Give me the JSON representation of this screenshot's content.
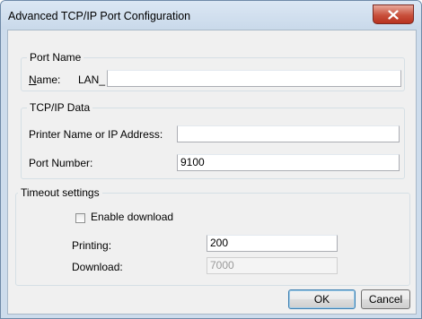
{
  "window": {
    "title": "Advanced TCP/IP Port Configuration"
  },
  "port_name": {
    "group_label": "Port Name",
    "name_label_prefix": "N",
    "name_label_rest": "ame:",
    "name_value": "LAN_"
  },
  "tcpip_data": {
    "group_label": "TCP/IP Data",
    "printer_label": "Printer Name or IP Address:",
    "printer_value": "",
    "port_number_label": "Port Number:",
    "port_number_value": "9100"
  },
  "timeout": {
    "group_label": "Timeout settings",
    "enable_download_label": "Enable download",
    "enable_download_checked": false,
    "printing_label": "Printing:",
    "printing_value": "200",
    "download_label": "Download:",
    "download_value": "7000"
  },
  "buttons": {
    "ok": "OK",
    "cancel": "Cancel"
  }
}
